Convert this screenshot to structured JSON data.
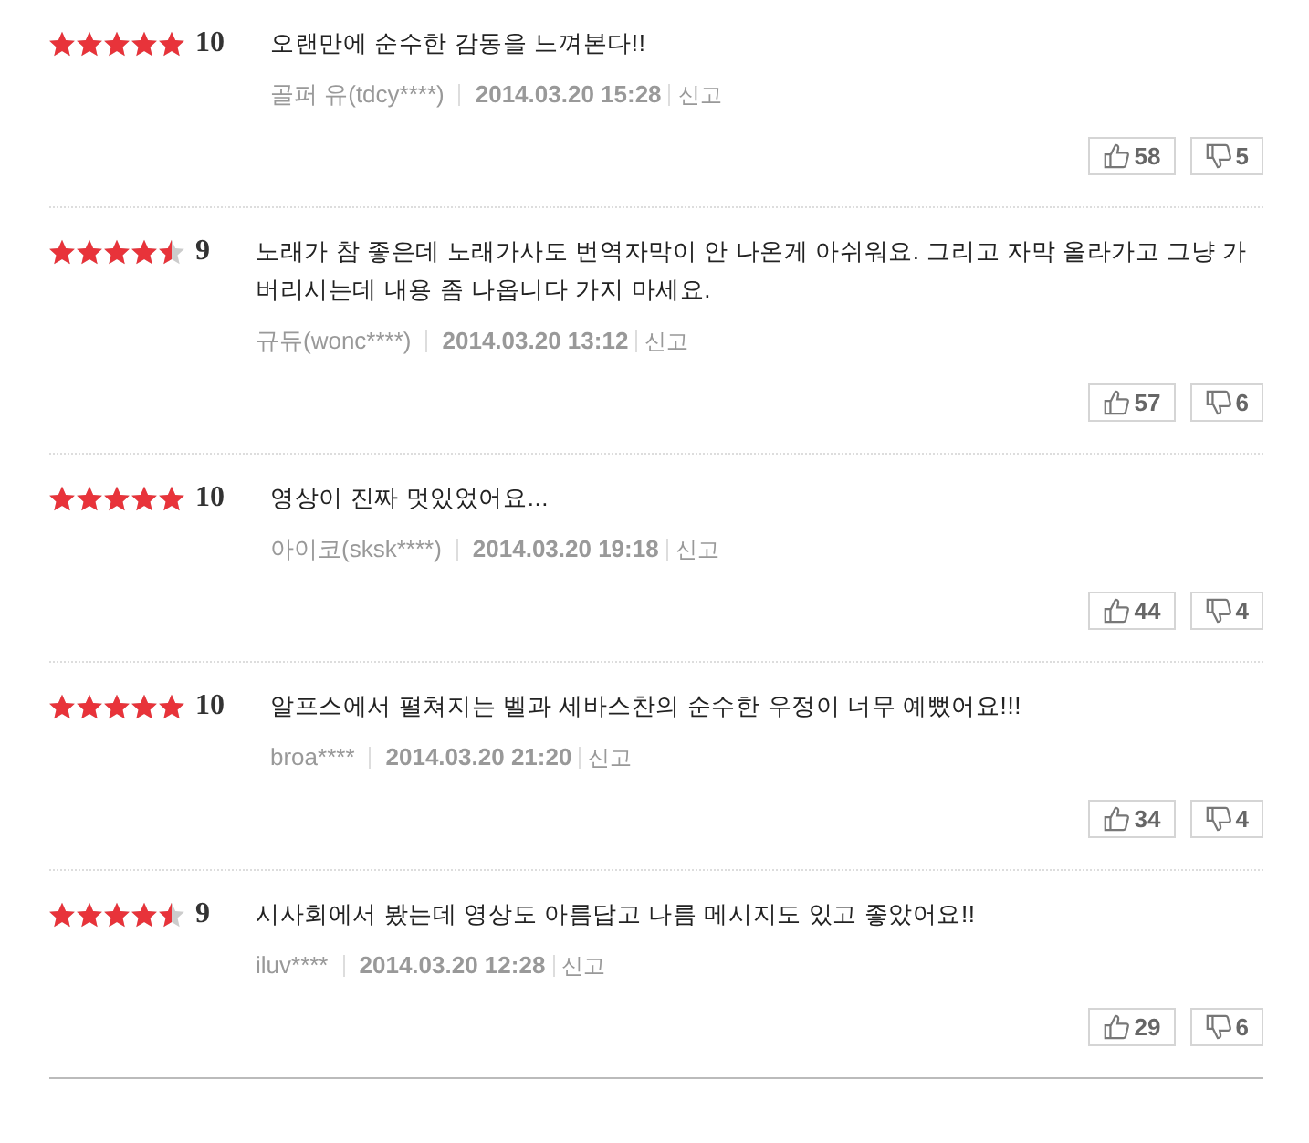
{
  "reviews": [
    {
      "stars": 5,
      "score": "10",
      "comment": "오랜만에 순수한 감동을 느껴본다!!",
      "author": "골퍼 유(tdcy****)",
      "date": "2014.03.20 15:28",
      "report": "신고",
      "likes": "58",
      "dislikes": "5"
    },
    {
      "stars": 4.5,
      "score": "9",
      "comment": "노래가 참 좋은데 노래가사도 번역자막이 안 나온게 아쉬워요. 그리고 자막 올라가고 그냥 가버리시는데 내용 좀 나옵니다 가지 마세요.",
      "author": "규듀(wonc****)",
      "date": "2014.03.20 13:12",
      "report": "신고",
      "likes": "57",
      "dislikes": "6"
    },
    {
      "stars": 5,
      "score": "10",
      "comment": "영상이 진짜 멋있었어요...",
      "author": "아이코(sksk****)",
      "date": "2014.03.20 19:18",
      "report": "신고",
      "likes": "44",
      "dislikes": "4"
    },
    {
      "stars": 5,
      "score": "10",
      "comment": "알프스에서 펼쳐지는 벨과 세바스찬의 순수한 우정이 너무 예뻤어요!!!",
      "author": "broa****",
      "date": "2014.03.20 21:20",
      "report": "신고",
      "likes": "34",
      "dislikes": "4"
    },
    {
      "stars": 4.5,
      "score": "9",
      "comment": "시사회에서 봤는데 영상도 아름답고 나름 메시지도 있고 좋았어요!!",
      "author": "iluv****",
      "date": "2014.03.20 12:28",
      "report": "신고",
      "likes": "29",
      "dislikes": "6"
    }
  ]
}
